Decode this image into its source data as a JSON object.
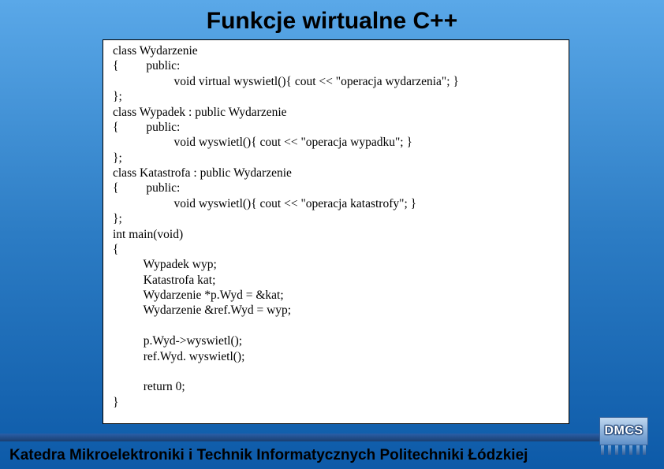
{
  "title": "Funkcje wirtualne C++",
  "code": "class Wydarzenie\n{         public:\n                    void virtual wyswietl(){ cout << \"operacja wydarzenia\"; }\n};\nclass Wypadek : public Wydarzenie\n{         public:\n                    void wyswietl(){ cout << \"operacja wypadku\"; }\n};\nclass Katastrofa : public Wydarzenie\n{         public:\n                    void wyswietl(){ cout << \"operacja katastrofy\"; }\n};\nint main(void)\n{\n          Wypadek wyp;\n          Katastrofa kat;\n          Wydarzenie *p.Wyd = &kat;\n          Wydarzenie &ref.Wyd = wyp;\n\n          p.Wyd->wyswietl();\n          ref.Wyd. wyswietl();\n\n          return 0;\n}",
  "footer": "Katedra Mikroelektroniki i Technik Informatycznych Politechniki Łódzkiej",
  "logo_text": "DMCS"
}
